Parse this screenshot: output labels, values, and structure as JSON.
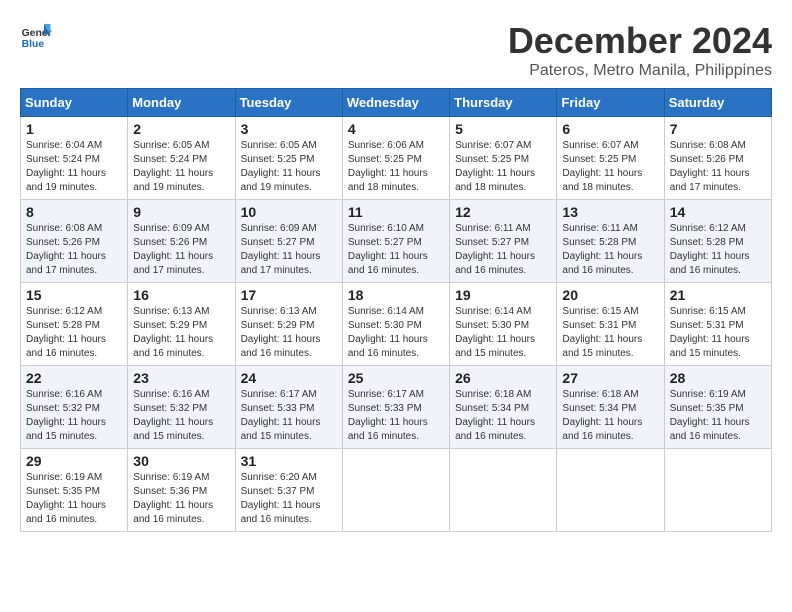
{
  "header": {
    "logo_general": "General",
    "logo_blue": "Blue",
    "month_title": "December 2024",
    "location": "Pateros, Metro Manila, Philippines"
  },
  "days_of_week": [
    "Sunday",
    "Monday",
    "Tuesday",
    "Wednesday",
    "Thursday",
    "Friday",
    "Saturday"
  ],
  "weeks": [
    [
      {
        "day": "1",
        "sunrise": "Sunrise: 6:04 AM",
        "sunset": "Sunset: 5:24 PM",
        "daylight": "Daylight: 11 hours and 19 minutes."
      },
      {
        "day": "2",
        "sunrise": "Sunrise: 6:05 AM",
        "sunset": "Sunset: 5:24 PM",
        "daylight": "Daylight: 11 hours and 19 minutes."
      },
      {
        "day": "3",
        "sunrise": "Sunrise: 6:05 AM",
        "sunset": "Sunset: 5:25 PM",
        "daylight": "Daylight: 11 hours and 19 minutes."
      },
      {
        "day": "4",
        "sunrise": "Sunrise: 6:06 AM",
        "sunset": "Sunset: 5:25 PM",
        "daylight": "Daylight: 11 hours and 18 minutes."
      },
      {
        "day": "5",
        "sunrise": "Sunrise: 6:07 AM",
        "sunset": "Sunset: 5:25 PM",
        "daylight": "Daylight: 11 hours and 18 minutes."
      },
      {
        "day": "6",
        "sunrise": "Sunrise: 6:07 AM",
        "sunset": "Sunset: 5:25 PM",
        "daylight": "Daylight: 11 hours and 18 minutes."
      },
      {
        "day": "7",
        "sunrise": "Sunrise: 6:08 AM",
        "sunset": "Sunset: 5:26 PM",
        "daylight": "Daylight: 11 hours and 17 minutes."
      }
    ],
    [
      {
        "day": "8",
        "sunrise": "Sunrise: 6:08 AM",
        "sunset": "Sunset: 5:26 PM",
        "daylight": "Daylight: 11 hours and 17 minutes."
      },
      {
        "day": "9",
        "sunrise": "Sunrise: 6:09 AM",
        "sunset": "Sunset: 5:26 PM",
        "daylight": "Daylight: 11 hours and 17 minutes."
      },
      {
        "day": "10",
        "sunrise": "Sunrise: 6:09 AM",
        "sunset": "Sunset: 5:27 PM",
        "daylight": "Daylight: 11 hours and 17 minutes."
      },
      {
        "day": "11",
        "sunrise": "Sunrise: 6:10 AM",
        "sunset": "Sunset: 5:27 PM",
        "daylight": "Daylight: 11 hours and 16 minutes."
      },
      {
        "day": "12",
        "sunrise": "Sunrise: 6:11 AM",
        "sunset": "Sunset: 5:27 PM",
        "daylight": "Daylight: 11 hours and 16 minutes."
      },
      {
        "day": "13",
        "sunrise": "Sunrise: 6:11 AM",
        "sunset": "Sunset: 5:28 PM",
        "daylight": "Daylight: 11 hours and 16 minutes."
      },
      {
        "day": "14",
        "sunrise": "Sunrise: 6:12 AM",
        "sunset": "Sunset: 5:28 PM",
        "daylight": "Daylight: 11 hours and 16 minutes."
      }
    ],
    [
      {
        "day": "15",
        "sunrise": "Sunrise: 6:12 AM",
        "sunset": "Sunset: 5:28 PM",
        "daylight": "Daylight: 11 hours and 16 minutes."
      },
      {
        "day": "16",
        "sunrise": "Sunrise: 6:13 AM",
        "sunset": "Sunset: 5:29 PM",
        "daylight": "Daylight: 11 hours and 16 minutes."
      },
      {
        "day": "17",
        "sunrise": "Sunrise: 6:13 AM",
        "sunset": "Sunset: 5:29 PM",
        "daylight": "Daylight: 11 hours and 16 minutes."
      },
      {
        "day": "18",
        "sunrise": "Sunrise: 6:14 AM",
        "sunset": "Sunset: 5:30 PM",
        "daylight": "Daylight: 11 hours and 16 minutes."
      },
      {
        "day": "19",
        "sunrise": "Sunrise: 6:14 AM",
        "sunset": "Sunset: 5:30 PM",
        "daylight": "Daylight: 11 hours and 15 minutes."
      },
      {
        "day": "20",
        "sunrise": "Sunrise: 6:15 AM",
        "sunset": "Sunset: 5:31 PM",
        "daylight": "Daylight: 11 hours and 15 minutes."
      },
      {
        "day": "21",
        "sunrise": "Sunrise: 6:15 AM",
        "sunset": "Sunset: 5:31 PM",
        "daylight": "Daylight: 11 hours and 15 minutes."
      }
    ],
    [
      {
        "day": "22",
        "sunrise": "Sunrise: 6:16 AM",
        "sunset": "Sunset: 5:32 PM",
        "daylight": "Daylight: 11 hours and 15 minutes."
      },
      {
        "day": "23",
        "sunrise": "Sunrise: 6:16 AM",
        "sunset": "Sunset: 5:32 PM",
        "daylight": "Daylight: 11 hours and 15 minutes."
      },
      {
        "day": "24",
        "sunrise": "Sunrise: 6:17 AM",
        "sunset": "Sunset: 5:33 PM",
        "daylight": "Daylight: 11 hours and 15 minutes."
      },
      {
        "day": "25",
        "sunrise": "Sunrise: 6:17 AM",
        "sunset": "Sunset: 5:33 PM",
        "daylight": "Daylight: 11 hours and 16 minutes."
      },
      {
        "day": "26",
        "sunrise": "Sunrise: 6:18 AM",
        "sunset": "Sunset: 5:34 PM",
        "daylight": "Daylight: 11 hours and 16 minutes."
      },
      {
        "day": "27",
        "sunrise": "Sunrise: 6:18 AM",
        "sunset": "Sunset: 5:34 PM",
        "daylight": "Daylight: 11 hours and 16 minutes."
      },
      {
        "day": "28",
        "sunrise": "Sunrise: 6:19 AM",
        "sunset": "Sunset: 5:35 PM",
        "daylight": "Daylight: 11 hours and 16 minutes."
      }
    ],
    [
      {
        "day": "29",
        "sunrise": "Sunrise: 6:19 AM",
        "sunset": "Sunset: 5:35 PM",
        "daylight": "Daylight: 11 hours and 16 minutes."
      },
      {
        "day": "30",
        "sunrise": "Sunrise: 6:19 AM",
        "sunset": "Sunset: 5:36 PM",
        "daylight": "Daylight: 11 hours and 16 minutes."
      },
      {
        "day": "31",
        "sunrise": "Sunrise: 6:20 AM",
        "sunset": "Sunset: 5:37 PM",
        "daylight": "Daylight: 11 hours and 16 minutes."
      },
      null,
      null,
      null,
      null
    ]
  ]
}
